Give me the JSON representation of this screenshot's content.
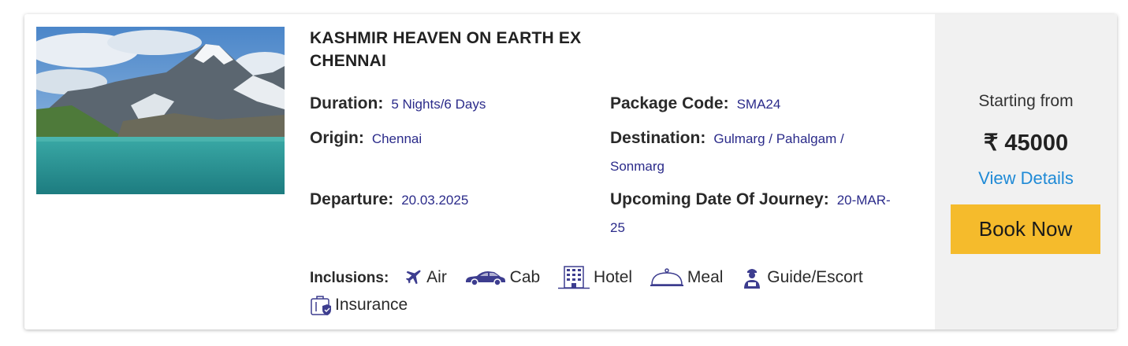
{
  "package": {
    "title": "KASHMIR HEAVEN ON EARTH EX CHENNAI",
    "image_alt": "Mountain lake with snow-capped peaks",
    "fields": {
      "duration": {
        "label": "Duration:",
        "value": "5 Nights/6 Days"
      },
      "origin": {
        "label": "Origin:",
        "value": "Chennai"
      },
      "departure": {
        "label": "Departure:",
        "value": "20.03.2025"
      },
      "package_code": {
        "label": "Package Code:",
        "value": "SMA24"
      },
      "destination": {
        "label": "Destination:",
        "value": "Gulmarg / Pahalgam / Sonmarg"
      },
      "upcoming": {
        "label": "Upcoming Date Of Journey:",
        "value": "20-MAR-25"
      }
    },
    "inclusions": {
      "label": "Inclusions:",
      "items": [
        {
          "label": "Air",
          "icon": "airplane-icon"
        },
        {
          "label": "Cab",
          "icon": "car-icon"
        },
        {
          "label": "Hotel",
          "icon": "hotel-icon"
        },
        {
          "label": "Meal",
          "icon": "cloche-icon"
        },
        {
          "label": "Guide/Escort",
          "icon": "guide-icon"
        },
        {
          "label": "Insurance",
          "icon": "insurance-icon"
        }
      ]
    }
  },
  "pricing": {
    "starting_label": "Starting from",
    "price": "₹ 45000",
    "view_details": "View Details",
    "book_now": "Book Now"
  },
  "colors": {
    "accent_button": "#f5bb2c",
    "link": "#1f8ad6",
    "value_text": "#2b2b8a",
    "icon": "#3d3d8f",
    "side_panel": "#f1f1f1"
  }
}
